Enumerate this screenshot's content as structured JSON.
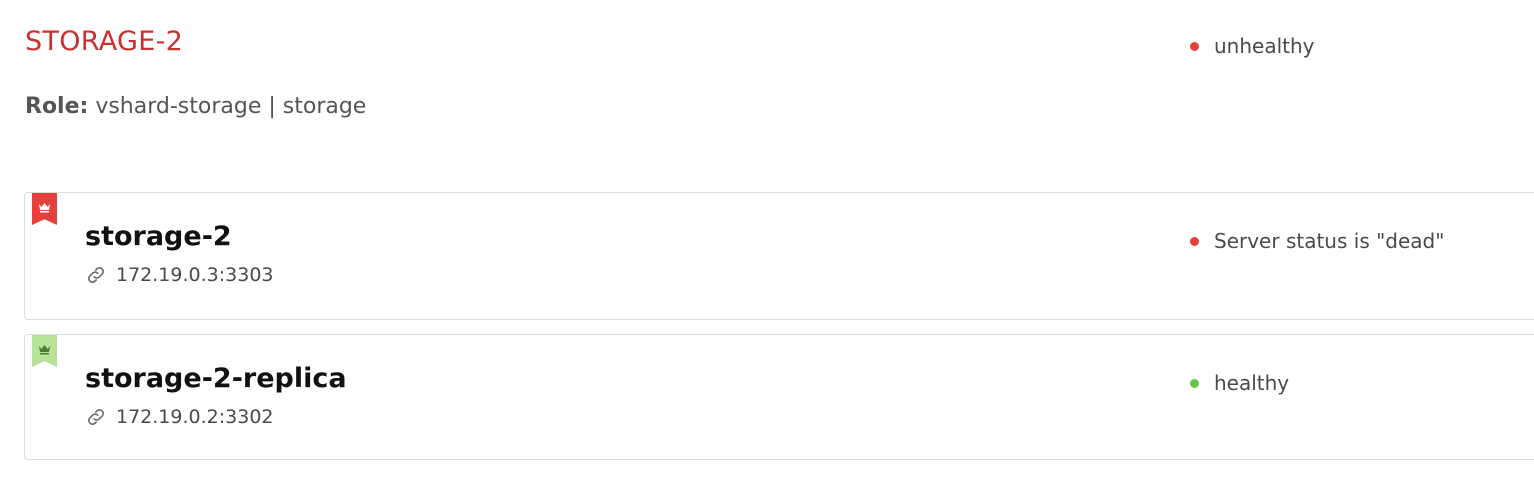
{
  "replicaset": {
    "title": "STORAGE-2",
    "status": {
      "text": "unhealthy",
      "color": "#e5403b"
    },
    "role_label": "Role:",
    "role_value": "vshard-storage | storage"
  },
  "servers": [
    {
      "name": "storage-2",
      "uri": "172.19.0.3:3303",
      "status": {
        "text": "Server status is \"dead\"",
        "color": "#e5403b"
      },
      "leader_flag": {
        "icon": "crown-icon",
        "color": "#e5403b"
      }
    },
    {
      "name": "storage-2-replica",
      "uri": "172.19.0.2:3302",
      "status": {
        "text": "healthy",
        "color": "#68c447"
      },
      "leader_flag": {
        "icon": "crown-icon",
        "color": "#b6e29a"
      }
    }
  ]
}
